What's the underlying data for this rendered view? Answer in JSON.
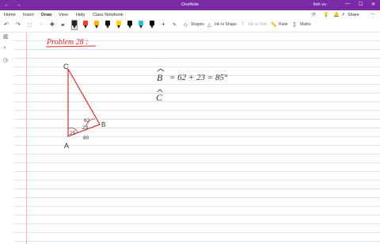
{
  "app": {
    "title": "OneNote",
    "user": "linh vu"
  },
  "menu": {
    "tabs": [
      "Home",
      "Insert",
      "Draw",
      "View",
      "Help",
      "Class Notebook"
    ],
    "active": "Draw"
  },
  "toolbar": {
    "shapes_label": "Shapes",
    "ink_to_shape_label": "Ink to Shape",
    "ink_to_text_label": "Ink to Text",
    "ruler_label": "Ruler",
    "maths_label": "Maths",
    "share_label": "Share"
  },
  "colors": {
    "title_bar": "#7b2aa6",
    "red_ink": "#d62a2a",
    "dark_ink": "#333333",
    "pens": [
      "#222222",
      "#ff3b30",
      "#f5b400",
      "#111111",
      "#ffd400",
      "#22c4d8",
      "#000000"
    ]
  },
  "ink": {
    "heading": "Problem 28 :",
    "vertex_c": "C",
    "vertex_a": "A",
    "vertex_b": "B",
    "angle_62": "62",
    "angle_23": "23",
    "angle_25": "25",
    "angle_80": "80",
    "eq_b": "B",
    "eq_rest": "= 62 + 23 = 85°",
    "next_c": "C"
  }
}
